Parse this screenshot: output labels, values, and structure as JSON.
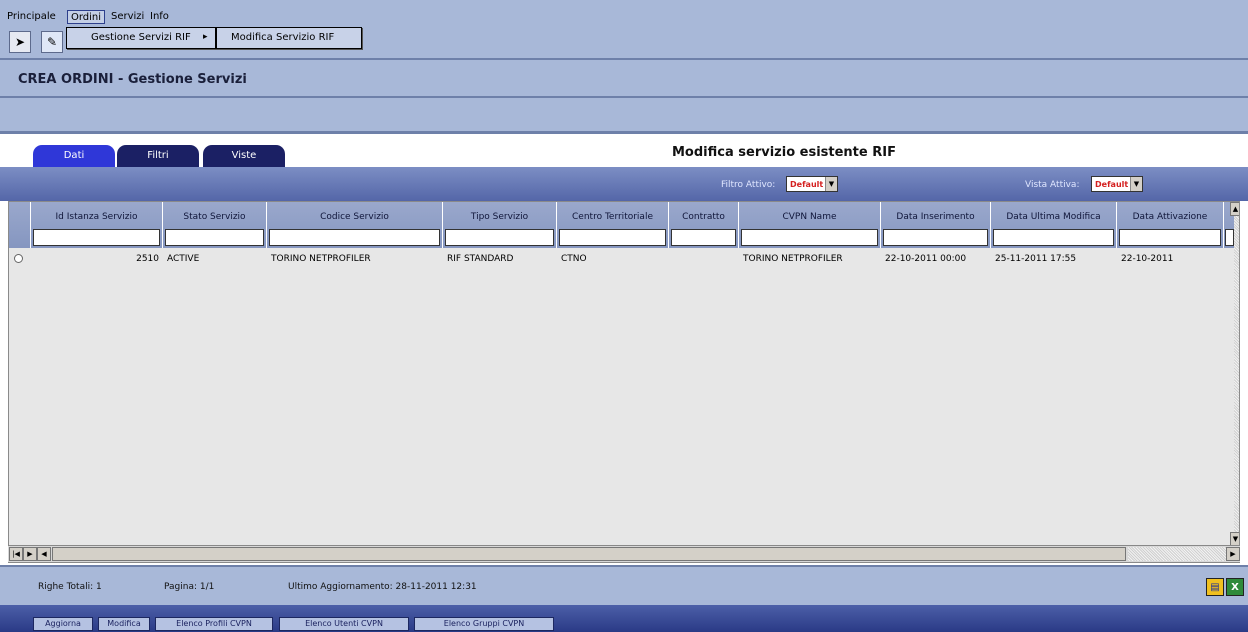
{
  "menu": {
    "items": [
      "Principale",
      "Ordini",
      "Servizi",
      "Info"
    ],
    "active": "Ordini",
    "submenu": {
      "item": "Gestione Servizi RIF",
      "arrow": "▸",
      "child": "Modifica Servizio RIF"
    }
  },
  "toolbar": {
    "exit_icon": "exit-door-icon",
    "edit_icon": "edit-icon"
  },
  "page": {
    "title": "CREA ORDINI - Gestione Servizi"
  },
  "tabs": [
    {
      "label": "Dati",
      "active": true
    },
    {
      "label": "Filtri",
      "active": false
    },
    {
      "label": "Viste",
      "active": false
    }
  ],
  "section_title": "Modifica servizio esistente RIF",
  "filters": {
    "filtro_label": "Filtro Attivo:",
    "filtro_value": "Default",
    "vista_label": "Vista Attiva:",
    "vista_value": "Default"
  },
  "grid": {
    "columns": [
      "Id Istanza Servizio",
      "Stato Servizio",
      "Codice Servizio",
      "Tipo Servizio",
      "Centro Territoriale",
      "Contratto",
      "CVPN Name",
      "Data Inserimento",
      "Data Ultima Modifica",
      "Data Attivazione"
    ],
    "rows": [
      {
        "id": "2510",
        "stato": "ACTIVE",
        "codice": "TORINO NETPROFILER",
        "tipo": "RIF STANDARD",
        "centro": "CTNO",
        "contratto": "",
        "cvpn": "TORINO NETPROFILER",
        "data_inserimento": "22-10-2011 00:00",
        "data_modifica": "25-11-2011 17:55",
        "data_attivazione": "22-10-2011"
      }
    ]
  },
  "status": {
    "righe": "Righe Totali: 1",
    "pagina": "Pagina: 1/1",
    "aggiornamento": "Ultimo Aggiornamento: 28-11-2011 12:31"
  },
  "actions": [
    "Aggiorna",
    "Modifica",
    "Elenco Profili CVPN",
    "Elenco Utenti CVPN",
    "Elenco Gruppi CVPN"
  ],
  "colors": {
    "tab_active": "#2f37d8",
    "tab_inactive": "#1b2064",
    "band": "#a8b8d8",
    "filter_value": "#d42020"
  }
}
